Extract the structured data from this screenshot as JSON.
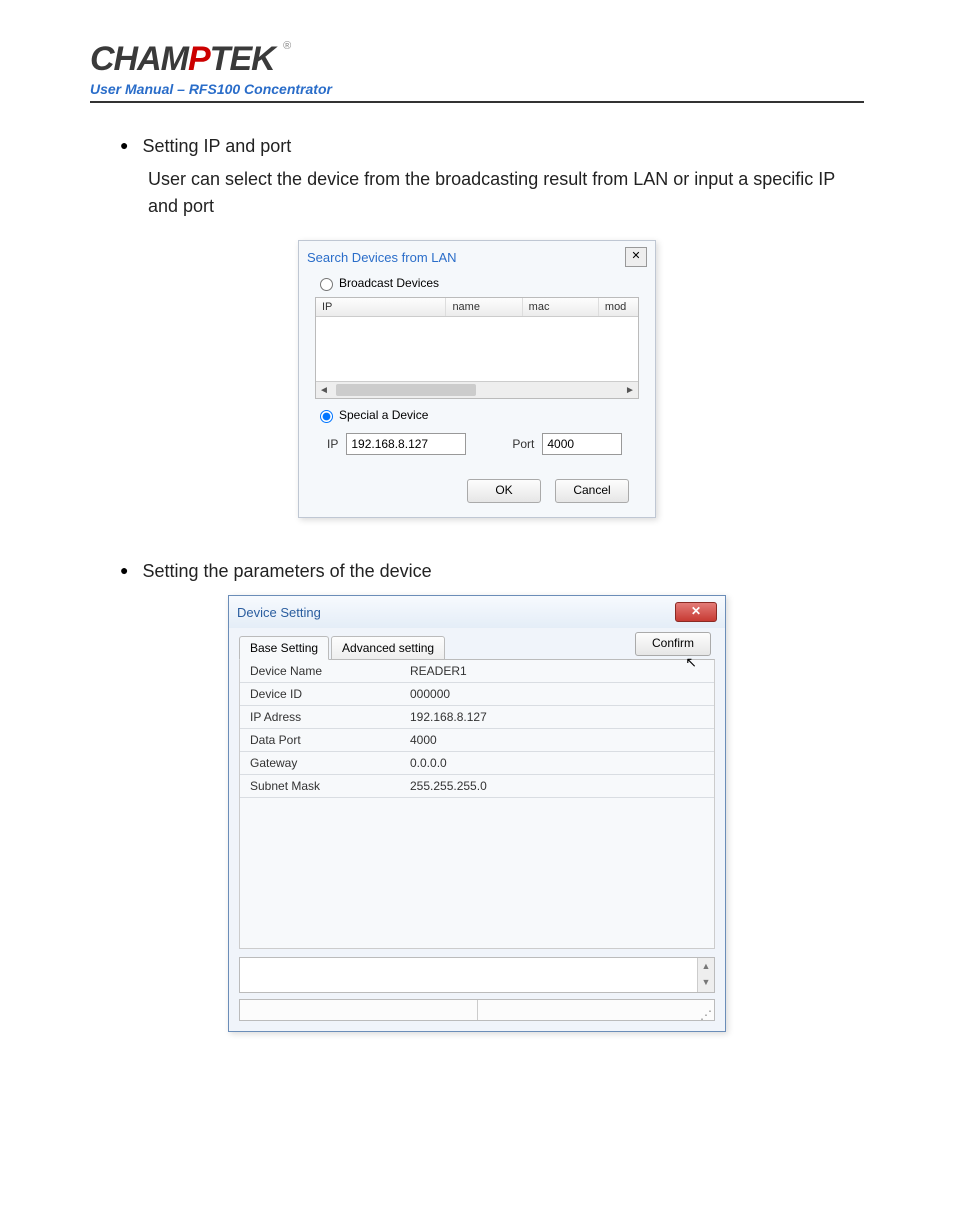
{
  "header": {
    "logo_pre": "CHAM",
    "logo_mid": "P",
    "logo_post": "TEK",
    "reg": "®",
    "subtitle": "User Manual – RFS100 Concentrator"
  },
  "section1": {
    "bullet_title": "Setting IP and port",
    "desc": "User can select the device from the broadcasting result from LAN or input a specific IP and port"
  },
  "dialog1": {
    "title": "Search Devices from LAN",
    "close": "✕",
    "radio_broadcast": "Broadcast Devices",
    "radio_special": "Special a Device",
    "col_ip": "IP",
    "col_name": "name",
    "col_mac": "mac",
    "col_mod": "mod",
    "ip_label": "IP",
    "ip_value": "192.168.8.127",
    "port_label": "Port",
    "port_value": "4000",
    "ok": "OK",
    "cancel": "Cancel",
    "scroll_left": "◄",
    "scroll_right": "►"
  },
  "section2": {
    "bullet_title": "Setting the parameters of the device"
  },
  "dialog2": {
    "title": "Device Setting",
    "close": "✕",
    "tab_base": "Base Setting",
    "tab_adv": "Advanced setting",
    "confirm": "Confirm",
    "rows": [
      {
        "k": "Device Name",
        "v": "READER1"
      },
      {
        "k": "Device ID",
        "v": "000000"
      },
      {
        "k": "IP Adress",
        "v": "192.168.8.127"
      },
      {
        "k": "Data Port",
        "v": "4000"
      },
      {
        "k": "Gateway",
        "v": "0.0.0.0"
      },
      {
        "k": "Subnet Mask",
        "v": "255.255.255.0"
      }
    ],
    "scroll_up": "▲",
    "scroll_down": "▼",
    "grip": "⋰"
  }
}
